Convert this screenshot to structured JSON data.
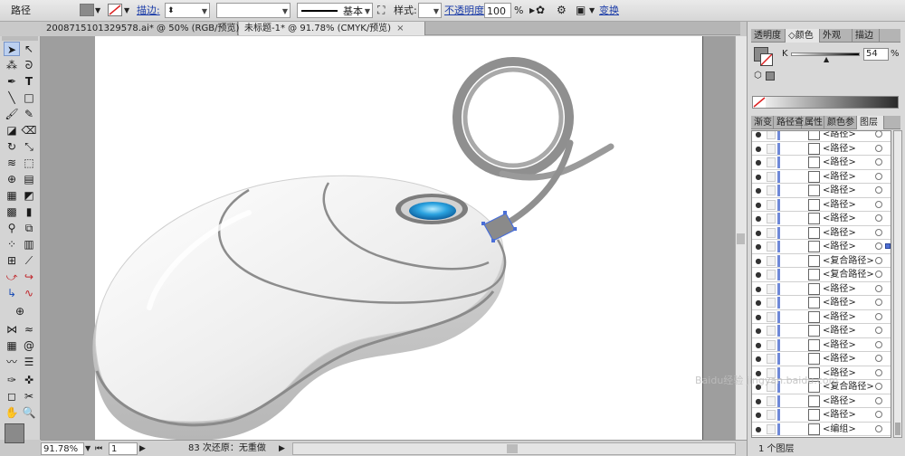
{
  "control_bar": {
    "object_type": "路径",
    "stroke_label": "描边:",
    "stroke_profile": "基本",
    "style_label": "样式:",
    "opacity_label": "不透明度",
    "opacity_value": "100",
    "opacity_unit": "%",
    "transform_label": "变换"
  },
  "document_tabs": [
    {
      "label": "2008715101329578.ai* @ 50% (RGB/预览)",
      "close": "×"
    },
    {
      "label": "未标题-1* @ 91.78% (CMYK/预览)",
      "close": "×"
    }
  ],
  "right_panel": {
    "top_tabs": [
      "透明度",
      "◇颜色",
      "外观",
      "描边"
    ],
    "color_channel": "K",
    "k_value": "54",
    "k_unit": "%",
    "bottom_tabs": [
      "渐变",
      "路径查",
      "属性",
      "颜色参",
      "图层"
    ],
    "layers": [
      "<路径>",
      "<路径>",
      "<路径>",
      "<路径>",
      "<路径>",
      "<路径>",
      "<路径>",
      "<路径>",
      "<路径>",
      "<复合路径>",
      "<复合路径>",
      "<路径>",
      "<路径>",
      "<路径>",
      "<路径>",
      "<路径>",
      "<路径>",
      "<路径>",
      "<复合路径>",
      "<路径>",
      "<路径>",
      "<编组>"
    ],
    "layer_count": "1 个图层"
  },
  "status_bar": {
    "zoom": "91.78%",
    "page": "1",
    "undo_text": "83 次还原：无重做"
  },
  "watermark": "Baidu经验 jingyan.baidu.com",
  "colors": {
    "selection_blue": "#4a6fd8",
    "fill_gray": "#8a8a8a",
    "wheel_blue": "#2ba3e0"
  }
}
